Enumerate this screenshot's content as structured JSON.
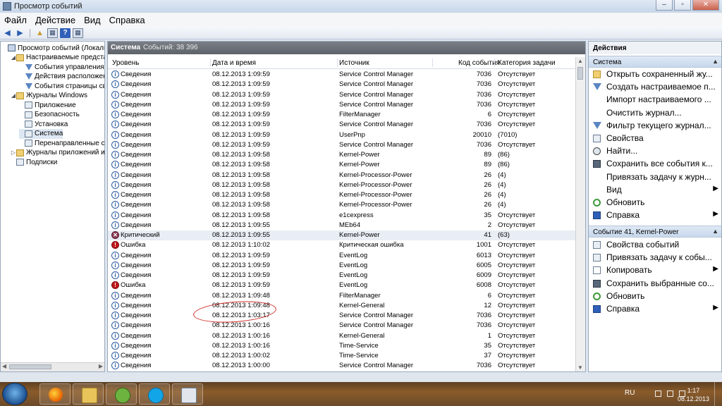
{
  "window": {
    "title": "Просмотр событий",
    "buttons": [
      "–",
      "▫",
      "✕"
    ]
  },
  "menu": [
    "Файл",
    "Действие",
    "Вид",
    "Справка"
  ],
  "tree": {
    "items": [
      {
        "label": "Просмотр событий (Локальный)",
        "indent": 0,
        "expander": "",
        "icon": "pc"
      },
      {
        "label": "Настраиваемые представления",
        "indent": 1,
        "expander": "◢",
        "icon": "folder"
      },
      {
        "label": "События управления",
        "indent": 2,
        "expander": "",
        "icon": "filter"
      },
      {
        "label": "Действия расположения",
        "indent": 2,
        "expander": "",
        "icon": "filter"
      },
      {
        "label": "События страницы сводки",
        "indent": 2,
        "expander": "",
        "icon": "filter"
      },
      {
        "label": "Журналы Windows",
        "indent": 1,
        "expander": "◢",
        "icon": "folder"
      },
      {
        "label": "Приложение",
        "indent": 2,
        "expander": "",
        "icon": "log"
      },
      {
        "label": "Безопасность",
        "indent": 2,
        "expander": "",
        "icon": "log"
      },
      {
        "label": "Установка",
        "indent": 2,
        "expander": "",
        "icon": "log"
      },
      {
        "label": "Система",
        "indent": 2,
        "expander": "",
        "icon": "log",
        "selected": true
      },
      {
        "label": "Перенаправленные события",
        "indent": 2,
        "expander": "",
        "icon": "log"
      },
      {
        "label": "Журналы приложений и служб",
        "indent": 1,
        "expander": "▷",
        "icon": "folder"
      },
      {
        "label": "Подписки",
        "indent": 1,
        "expander": "",
        "icon": "log"
      }
    ]
  },
  "center": {
    "log_name": "Система",
    "event_count": "Событий: 38 396",
    "columns": [
      "Уровень",
      "Дата и время",
      "Источник",
      "Код события",
      "Категория задачи"
    ],
    "rows": [
      [
        "info",
        "Сведения",
        "08.12.2013 1:09:59",
        "Service Control Manager",
        "7036",
        "Отсутствует"
      ],
      [
        "info",
        "Сведения",
        "08.12.2013 1:09:59",
        "Service Control Manager",
        "7036",
        "Отсутствует"
      ],
      [
        "info",
        "Сведения",
        "08.12.2013 1:09:59",
        "Service Control Manager",
        "7036",
        "Отсутствует"
      ],
      [
        "info",
        "Сведения",
        "08.12.2013 1:09:59",
        "Service Control Manager",
        "7036",
        "Отсутствует"
      ],
      [
        "info",
        "Сведения",
        "08.12.2013 1:09:59",
        "FilterManager",
        "6",
        "Отсутствует"
      ],
      [
        "info",
        "Сведения",
        "08.12.2013 1:09:59",
        "Service Control Manager",
        "7036",
        "Отсутствует"
      ],
      [
        "info",
        "Сведения",
        "08.12.2013 1:09:59",
        "UserPnp",
        "20010",
        "(7010)"
      ],
      [
        "info",
        "Сведения",
        "08.12.2013 1:09:59",
        "Service Control Manager",
        "7036",
        "Отсутствует"
      ],
      [
        "info",
        "Сведения",
        "08.12.2013 1:09:58",
        "Kernel-Power",
        "89",
        "(86)"
      ],
      [
        "info",
        "Сведения",
        "08.12.2013 1:09:58",
        "Kernel-Power",
        "89",
        "(86)"
      ],
      [
        "info",
        "Сведения",
        "08.12.2013 1:09:58",
        "Kernel-Processor-Power",
        "26",
        "(4)"
      ],
      [
        "info",
        "Сведения",
        "08.12.2013 1:09:58",
        "Kernel-Processor-Power",
        "26",
        "(4)"
      ],
      [
        "info",
        "Сведения",
        "08.12.2013 1:09:58",
        "Kernel-Processor-Power",
        "26",
        "(4)"
      ],
      [
        "info",
        "Сведения",
        "08.12.2013 1:09:58",
        "Kernel-Processor-Power",
        "26",
        "(4)"
      ],
      [
        "info",
        "Сведения",
        "08.12.2013 1:09:58",
        "e1cexpress",
        "35",
        "Отсутствует"
      ],
      [
        "info",
        "Сведения",
        "08.12.2013 1:09:55",
        "MEb64",
        "2",
        "Отсутствует"
      ],
      [
        "crit",
        "Критический",
        "08.12.2013 1:09:55",
        "Kernel-Power",
        "41",
        "(63)"
      ],
      [
        "err",
        "Ошибка",
        "08.12.2013 1:10:02",
        "Критическая ошибка",
        "1001",
        "Отсутствует"
      ],
      [
        "info",
        "Сведения",
        "08.12.2013 1:09:59",
        "EventLog",
        "6013",
        "Отсутствует"
      ],
      [
        "info",
        "Сведения",
        "08.12.2013 1:09:59",
        "EventLog",
        "6005",
        "Отсутствует"
      ],
      [
        "info",
        "Сведения",
        "08.12.2013 1:09:59",
        "EventLog",
        "6009",
        "Отсутствует"
      ],
      [
        "err",
        "Ошибка",
        "08.12.2013 1:09:59",
        "EventLog",
        "6008",
        "Отсутствует"
      ],
      [
        "info",
        "Сведения",
        "08.12.2013 1:09:48",
        "FilterManager",
        "6",
        "Отсутствует"
      ],
      [
        "info",
        "Сведения",
        "08.12.2013 1:09:48",
        "Kernel-General",
        "12",
        "Отсутствует"
      ],
      [
        "info",
        "Сведения",
        "08.12.2013 1:03:17",
        "Service Control Manager",
        "7036",
        "Отсутствует"
      ],
      [
        "info",
        "Сведения",
        "08.12.2013 1:00:16",
        "Service Control Manager",
        "7036",
        "Отсутствует"
      ],
      [
        "info",
        "Сведения",
        "08.12.2013 1:00:16",
        "Kernel-General",
        "1",
        "Отсутствует"
      ],
      [
        "info",
        "Сведения",
        "08.12.2013 1:00:16",
        "Time-Service",
        "35",
        "Отсутствует"
      ],
      [
        "info",
        "Сведения",
        "08.12.2013 1:00:02",
        "Time-Service",
        "37",
        "Отсутствует"
      ],
      [
        "info",
        "Сведения",
        "08.12.2013 1:00:00",
        "Service Control Manager",
        "7036",
        "Отсутствует"
      ]
    ],
    "selected_row": 16
  },
  "actions": {
    "title": "Действия",
    "section1": "Система",
    "items1": [
      {
        "label": "Открыть сохраненный жу...",
        "icon": "open",
        "arrow": ""
      },
      {
        "label": "Создать настраиваемое п...",
        "icon": "filter",
        "arrow": ""
      },
      {
        "label": "Импорт настраиваемого ...",
        "icon": "",
        "arrow": ""
      },
      {
        "label": "Очистить журнал...",
        "icon": "",
        "arrow": ""
      },
      {
        "label": "Фильтр текущего журнал...",
        "icon": "filter",
        "arrow": ""
      },
      {
        "label": "Свойства",
        "icon": "props",
        "arrow": ""
      },
      {
        "label": "Найти...",
        "icon": "find",
        "arrow": ""
      },
      {
        "label": "Сохранить все события к...",
        "icon": "save",
        "arrow": ""
      },
      {
        "label": "Привязать задачу к журн...",
        "icon": "",
        "arrow": ""
      },
      {
        "label": "Вид",
        "icon": "",
        "arrow": "▶"
      },
      {
        "label": "Обновить",
        "icon": "refresh",
        "arrow": ""
      },
      {
        "label": "Справка",
        "icon": "help",
        "arrow": "▶"
      }
    ],
    "section2": "Событие 41, Kernel-Power",
    "items2": [
      {
        "label": "Свойства событий",
        "icon": "props",
        "arrow": ""
      },
      {
        "label": "Привязать задачу к собы...",
        "icon": "task",
        "arrow": ""
      },
      {
        "label": "Копировать",
        "icon": "copy",
        "arrow": "▶"
      },
      {
        "label": "Сохранить выбранные со...",
        "icon": "save",
        "arrow": ""
      },
      {
        "label": "Обновить",
        "icon": "refresh",
        "arrow": ""
      },
      {
        "label": "Справка",
        "icon": "help",
        "arrow": "▶"
      }
    ]
  },
  "taskbar": {
    "apps": [
      "firefox-icon",
      "explorer-icon",
      "utorrent-icon",
      "skype-icon",
      "event-viewer-icon"
    ],
    "language": "RU",
    "time": "1:17",
    "date": "08.12.2013"
  }
}
